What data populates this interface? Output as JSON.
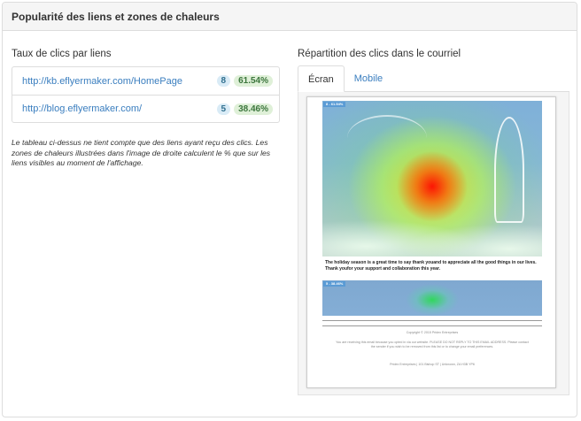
{
  "panel": {
    "title": "Popularité des liens et zones de chaleurs"
  },
  "left": {
    "title": "Taux de clics par liens",
    "links": [
      {
        "url": "http://kb.eflyermaker.com/HomePage",
        "count": "8",
        "percent": "61.54%"
      },
      {
        "url": "http://blog.eflyermaker.com/",
        "count": "5",
        "percent": "38.46%"
      }
    ],
    "note": "Le tableau ci-dessus ne tient compte que des liens ayant reçu des clics. Les zones de chaleurs illustrées dans l'image de droite calculent le % que sur les liens visibles au moment de l'affichage."
  },
  "right": {
    "title": "Répartition des clics dans le courriel",
    "tabs": [
      {
        "label": "Écran",
        "active": true
      },
      {
        "label": "Mobile",
        "active": false
      }
    ]
  },
  "email": {
    "flag1": "8 - 61.54%",
    "flag2": "5 - 38.46%",
    "body_text": "The holiday season is a great time to say thank youand to appreciate all the good things in our lives. Thank youfor your support and collaboration this year.",
    "copyright": "Copyright © 2015 Pridex Entreprises",
    "footer_text": "You are receiving this email because you opted in via our website. PLEASE DO NOT REPLY TO THIS EMAIL ADDRESS. Please contact the sender if you wish to be removed from this list or to change your email preferences.",
    "address": "Pridex Entreprises | 101 Bishop ST | Unknown, ZA H3B YP6"
  }
}
